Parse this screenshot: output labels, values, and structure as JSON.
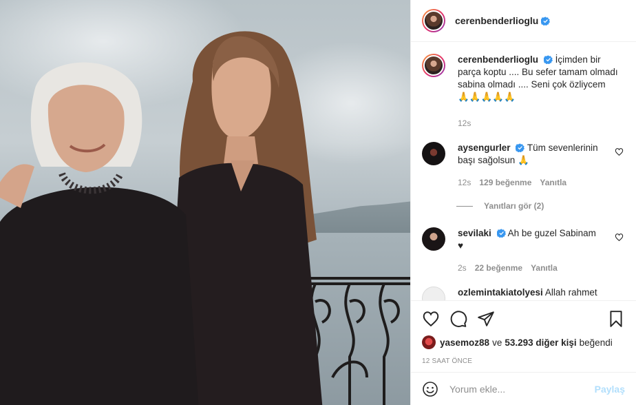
{
  "post": {
    "username": "cerenbenderlioglu",
    "caption_lines": [
      "İçimden bir",
      "parça koptu .... Bu sefer tamam olmadı",
      "sabina olmadı .... Seni çok özliycem"
    ],
    "caption_emojis": "🙏🙏🙏🙏🙏",
    "caption_time": "12s"
  },
  "comments": [
    {
      "username": "aysengurler",
      "verified": true,
      "text_line1": "Tüm sevenlerinin",
      "text_line2": "başı sağolsun 🙏",
      "time": "12s",
      "likes": "129 beğenme",
      "reply": "Yanıtla",
      "view_replies": "Yanıtları gör (2)"
    },
    {
      "username": "sevilaki",
      "verified": true,
      "text_line1": "Ah be guzel Sabinam",
      "text_line2": "♥",
      "time": "2s",
      "likes": "22 beğenme",
      "reply": "Yanıtla"
    },
    {
      "username": "ozlemintakiatolyesi",
      "text_line1": "Allah rahmet"
    }
  ],
  "likes": {
    "liker": "yasemoz88",
    "connector": "ve",
    "count": "53.293 diğer kişi",
    "suffix": "beğendi"
  },
  "timestamp": "12 SAAT ÖNCE",
  "add_comment": {
    "placeholder": "Yorum ekle...",
    "share_label": "Paylaş"
  },
  "icons": {
    "like": "heart-icon",
    "comment": "comment-icon",
    "share": "paper-plane-icon",
    "save": "bookmark-icon",
    "verified": "verified-badge-icon",
    "emoji": "smiley-icon"
  },
  "colors": {
    "verified": "#3897f0",
    "share_button": "#b2dffc",
    "muted": "#8e8e8e"
  }
}
